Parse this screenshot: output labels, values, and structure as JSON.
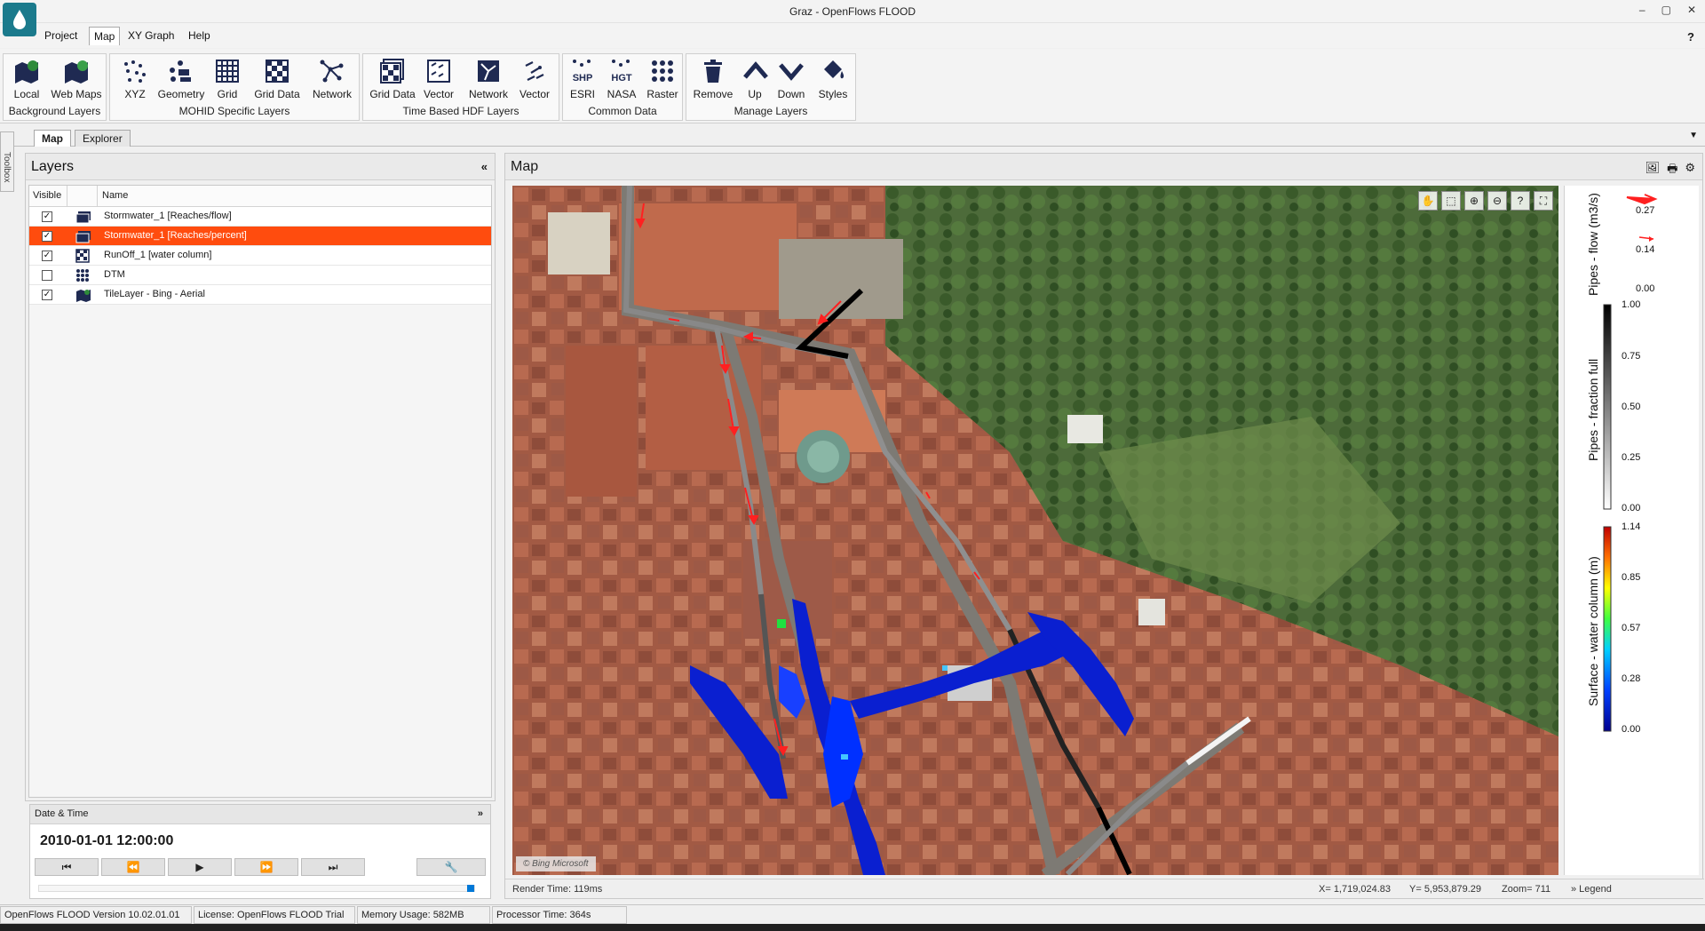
{
  "window": {
    "title": "Graz - OpenFlows FLOOD",
    "minimize": "–",
    "maximize": "▢",
    "close": "✕"
  },
  "menu": {
    "items": [
      "Project",
      "Map",
      "XY Graph",
      "Help"
    ],
    "active": "Map",
    "help": "?"
  },
  "ribbon": {
    "groups": [
      {
        "title": "Background Layers",
        "buttons": [
          {
            "label": "Local",
            "icon": "map-local-icon"
          },
          {
            "label": "Web Maps",
            "icon": "web-maps-icon"
          }
        ]
      },
      {
        "title": "MOHID Specific Layers",
        "buttons": [
          {
            "label": "XYZ",
            "icon": "xyz-icon"
          },
          {
            "label": "Geometry",
            "icon": "geometry-icon"
          },
          {
            "label": "Grid",
            "icon": "grid-icon"
          },
          {
            "label": "Grid Data",
            "icon": "grid-data-icon"
          },
          {
            "label": "Network",
            "icon": "network-icon"
          }
        ]
      },
      {
        "title": "Time Based HDF Layers",
        "buttons": [
          {
            "label": "Grid Data",
            "icon": "hdf-grid-data-icon"
          },
          {
            "label": "Vector",
            "icon": "hdf-vector-icon"
          },
          {
            "label": "Network",
            "icon": "hdf-network-icon"
          },
          {
            "label": "Vector",
            "icon": "vector-icon"
          }
        ]
      },
      {
        "title": "Common Data",
        "buttons": [
          {
            "label": "ESRI",
            "icon": "shp-icon",
            "badge": "SHP"
          },
          {
            "label": "NASA",
            "icon": "hgt-icon",
            "badge": "HGT"
          },
          {
            "label": "Raster",
            "icon": "raster-icon"
          }
        ]
      },
      {
        "title": "Manage Layers",
        "buttons": [
          {
            "label": "Remove",
            "icon": "trash-icon"
          },
          {
            "label": "Up",
            "icon": "chevron-up-icon"
          },
          {
            "label": "Down",
            "icon": "chevron-down-icon"
          },
          {
            "label": "Styles",
            "icon": "paint-bucket-icon"
          }
        ]
      }
    ]
  },
  "doc_tabs": [
    "Map",
    "Explorer"
  ],
  "toolbox": {
    "label": "Toolbox"
  },
  "layers": {
    "title": "Layers",
    "collapse": "«",
    "columns": [
      "Visible",
      "",
      "Name"
    ],
    "rows": [
      {
        "visible": true,
        "name": "Stormwater_1 [Reaches/flow]",
        "selected": false
      },
      {
        "visible": true,
        "name": "Stormwater_1 [Reaches/percent]",
        "selected": true
      },
      {
        "visible": true,
        "name": "RunOff_1 [water column]",
        "selected": false
      },
      {
        "visible": false,
        "name": "DTM",
        "selected": false
      },
      {
        "visible": true,
        "name": "TileLayer - Bing - Aerial",
        "selected": false
      }
    ]
  },
  "datetime": {
    "title": "Date & Time",
    "chevron": "»",
    "value": "2010-01-01 12:00:00",
    "progress": 1.0
  },
  "map": {
    "title": "Map",
    "attribution": "© Bing Microsoft",
    "render_time": "Render Time: 119ms",
    "x_coord": "X= 1,719,024.83",
    "y_coord": "Y= 5,953,879.29",
    "zoom": "Zoom= 711",
    "legend_toggle": "»  Legend"
  },
  "legend": {
    "flow": {
      "label": "Pipes - flow (m3/s)",
      "values": [
        "0.27",
        "0.14",
        "0.00"
      ]
    },
    "fraction": {
      "label": "Pipes - fraction full",
      "ticks": [
        "1.00",
        "0.75",
        "0.50",
        "0.25",
        "0.00"
      ]
    },
    "water": {
      "label": "Surface - water column (m)",
      "ticks": [
        "1.14",
        "0.85",
        "0.57",
        "0.28",
        "0.00"
      ]
    }
  },
  "status": {
    "version": "OpenFlows FLOOD Version 10.02.01.01",
    "license": "License: OpenFlows FLOOD Trial",
    "memory": "Memory Usage: 582MB",
    "processor": "Processor Time: 364s"
  },
  "colors": {
    "selected_row": "#ff4c0e",
    "accent": "#1b7a8c",
    "flow_arrow": "#ff2020",
    "water_low": "#0000a0",
    "water_high": "#d00000"
  }
}
